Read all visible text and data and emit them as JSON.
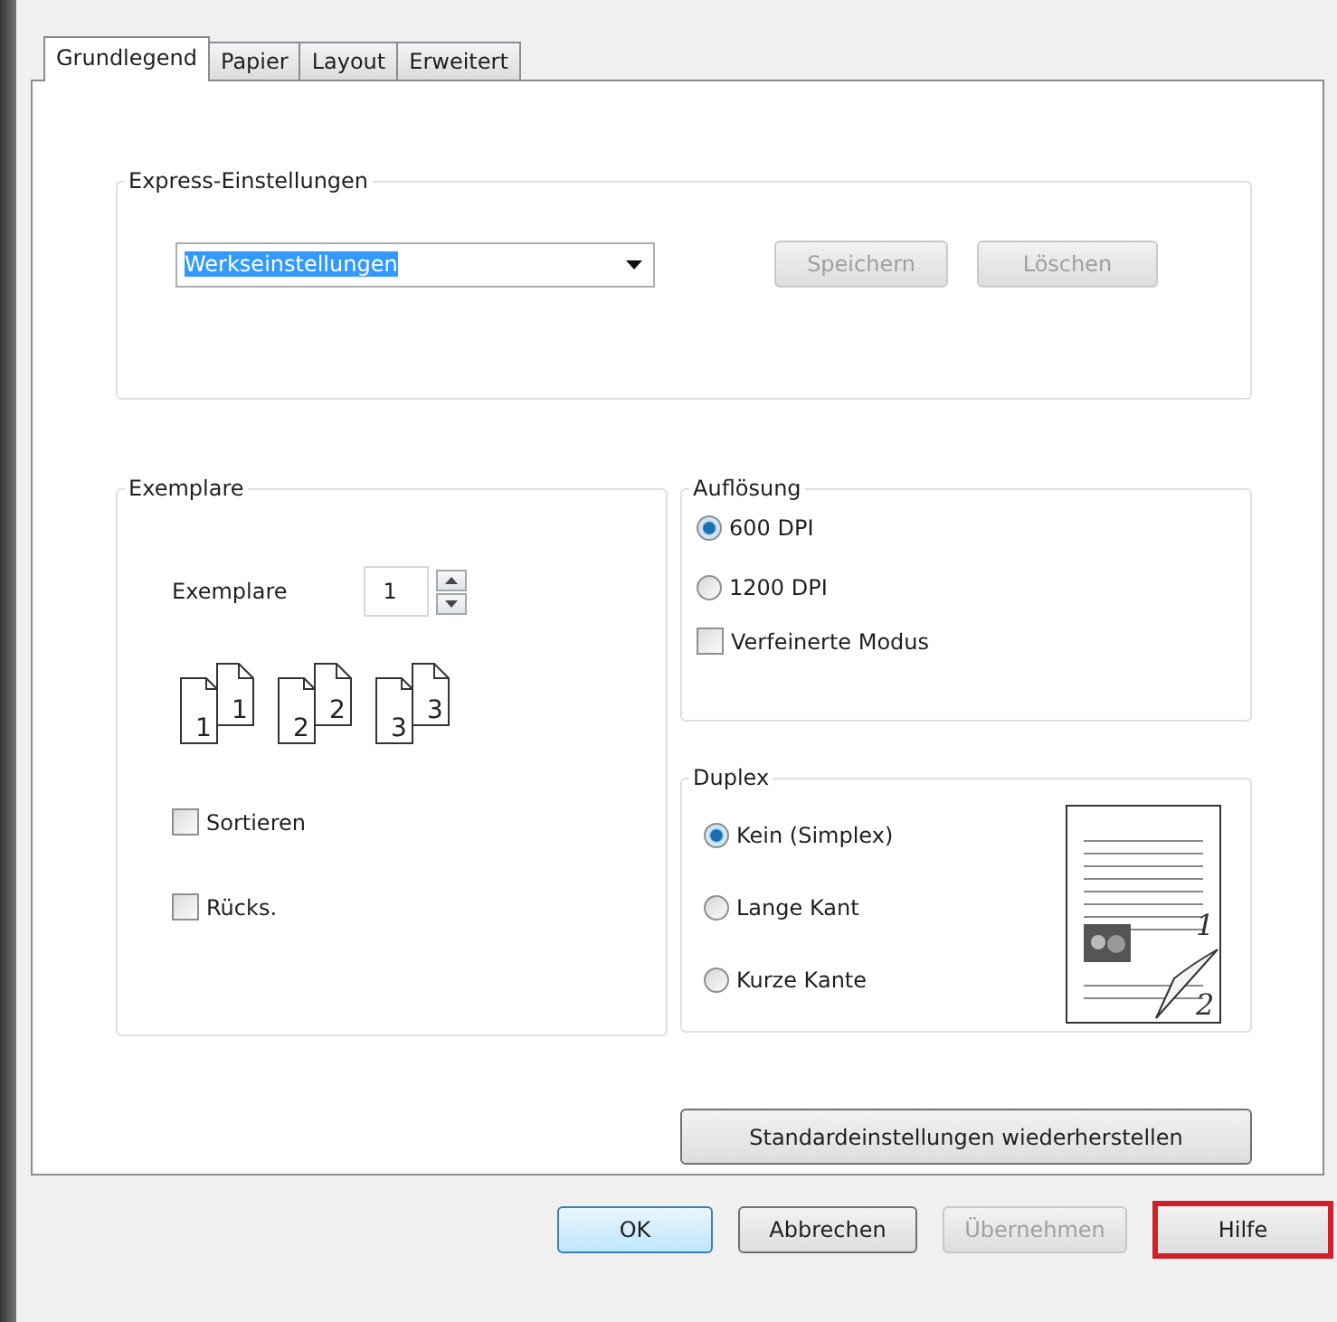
{
  "tabs": [
    {
      "label": "Grundlegend",
      "selected": true
    },
    {
      "label": "Papier",
      "selected": false
    },
    {
      "label": "Layout",
      "selected": false
    },
    {
      "label": "Erweitert",
      "selected": false
    }
  ],
  "express": {
    "title": "Express-Einstellungen",
    "dropdown": {
      "value": "Werkseinstellungen"
    },
    "buttons": [
      {
        "label": "Speichern",
        "disabled": true
      },
      {
        "label": "Löschen",
        "disabled": true
      }
    ]
  },
  "copies": {
    "title": "Exemplare",
    "label": "Exemplare",
    "value": "1",
    "pages": [
      [
        "1",
        "1"
      ],
      [
        "2",
        "2"
      ],
      [
        "3",
        "3"
      ]
    ],
    "options": [
      {
        "label": "Sortieren",
        "checked": false
      },
      {
        "label": "Rücks.",
        "checked": false
      }
    ]
  },
  "resolution": {
    "title": "Auflösung",
    "options": [
      {
        "kind": "radio",
        "label": "600 DPI",
        "selected": true
      },
      {
        "kind": "radio",
        "label": "1200 DPI",
        "selected": false
      },
      {
        "kind": "checkbox",
        "label": "Verfeinerte Modus",
        "checked": false
      }
    ]
  },
  "duplex": {
    "title": "Duplex",
    "options": [
      {
        "label": "Kein (Simplex)",
        "selected": true
      },
      {
        "label": "Lange Kant",
        "selected": false
      },
      {
        "label": "Kurze Kante",
        "selected": false
      }
    ],
    "preview": {
      "front": "1",
      "back": "2"
    }
  },
  "restore_button": "Standardeinstellungen wiederherstellen",
  "footer_buttons": [
    {
      "label": "OK",
      "default": true,
      "disabled": false,
      "highlighted": false
    },
    {
      "label": "Abbrechen",
      "default": false,
      "disabled": false,
      "highlighted": false
    },
    {
      "label": "Übernehmen",
      "default": false,
      "disabled": true,
      "highlighted": false
    },
    {
      "label": "Hilfe",
      "default": false,
      "disabled": false,
      "highlighted": true
    }
  ]
}
